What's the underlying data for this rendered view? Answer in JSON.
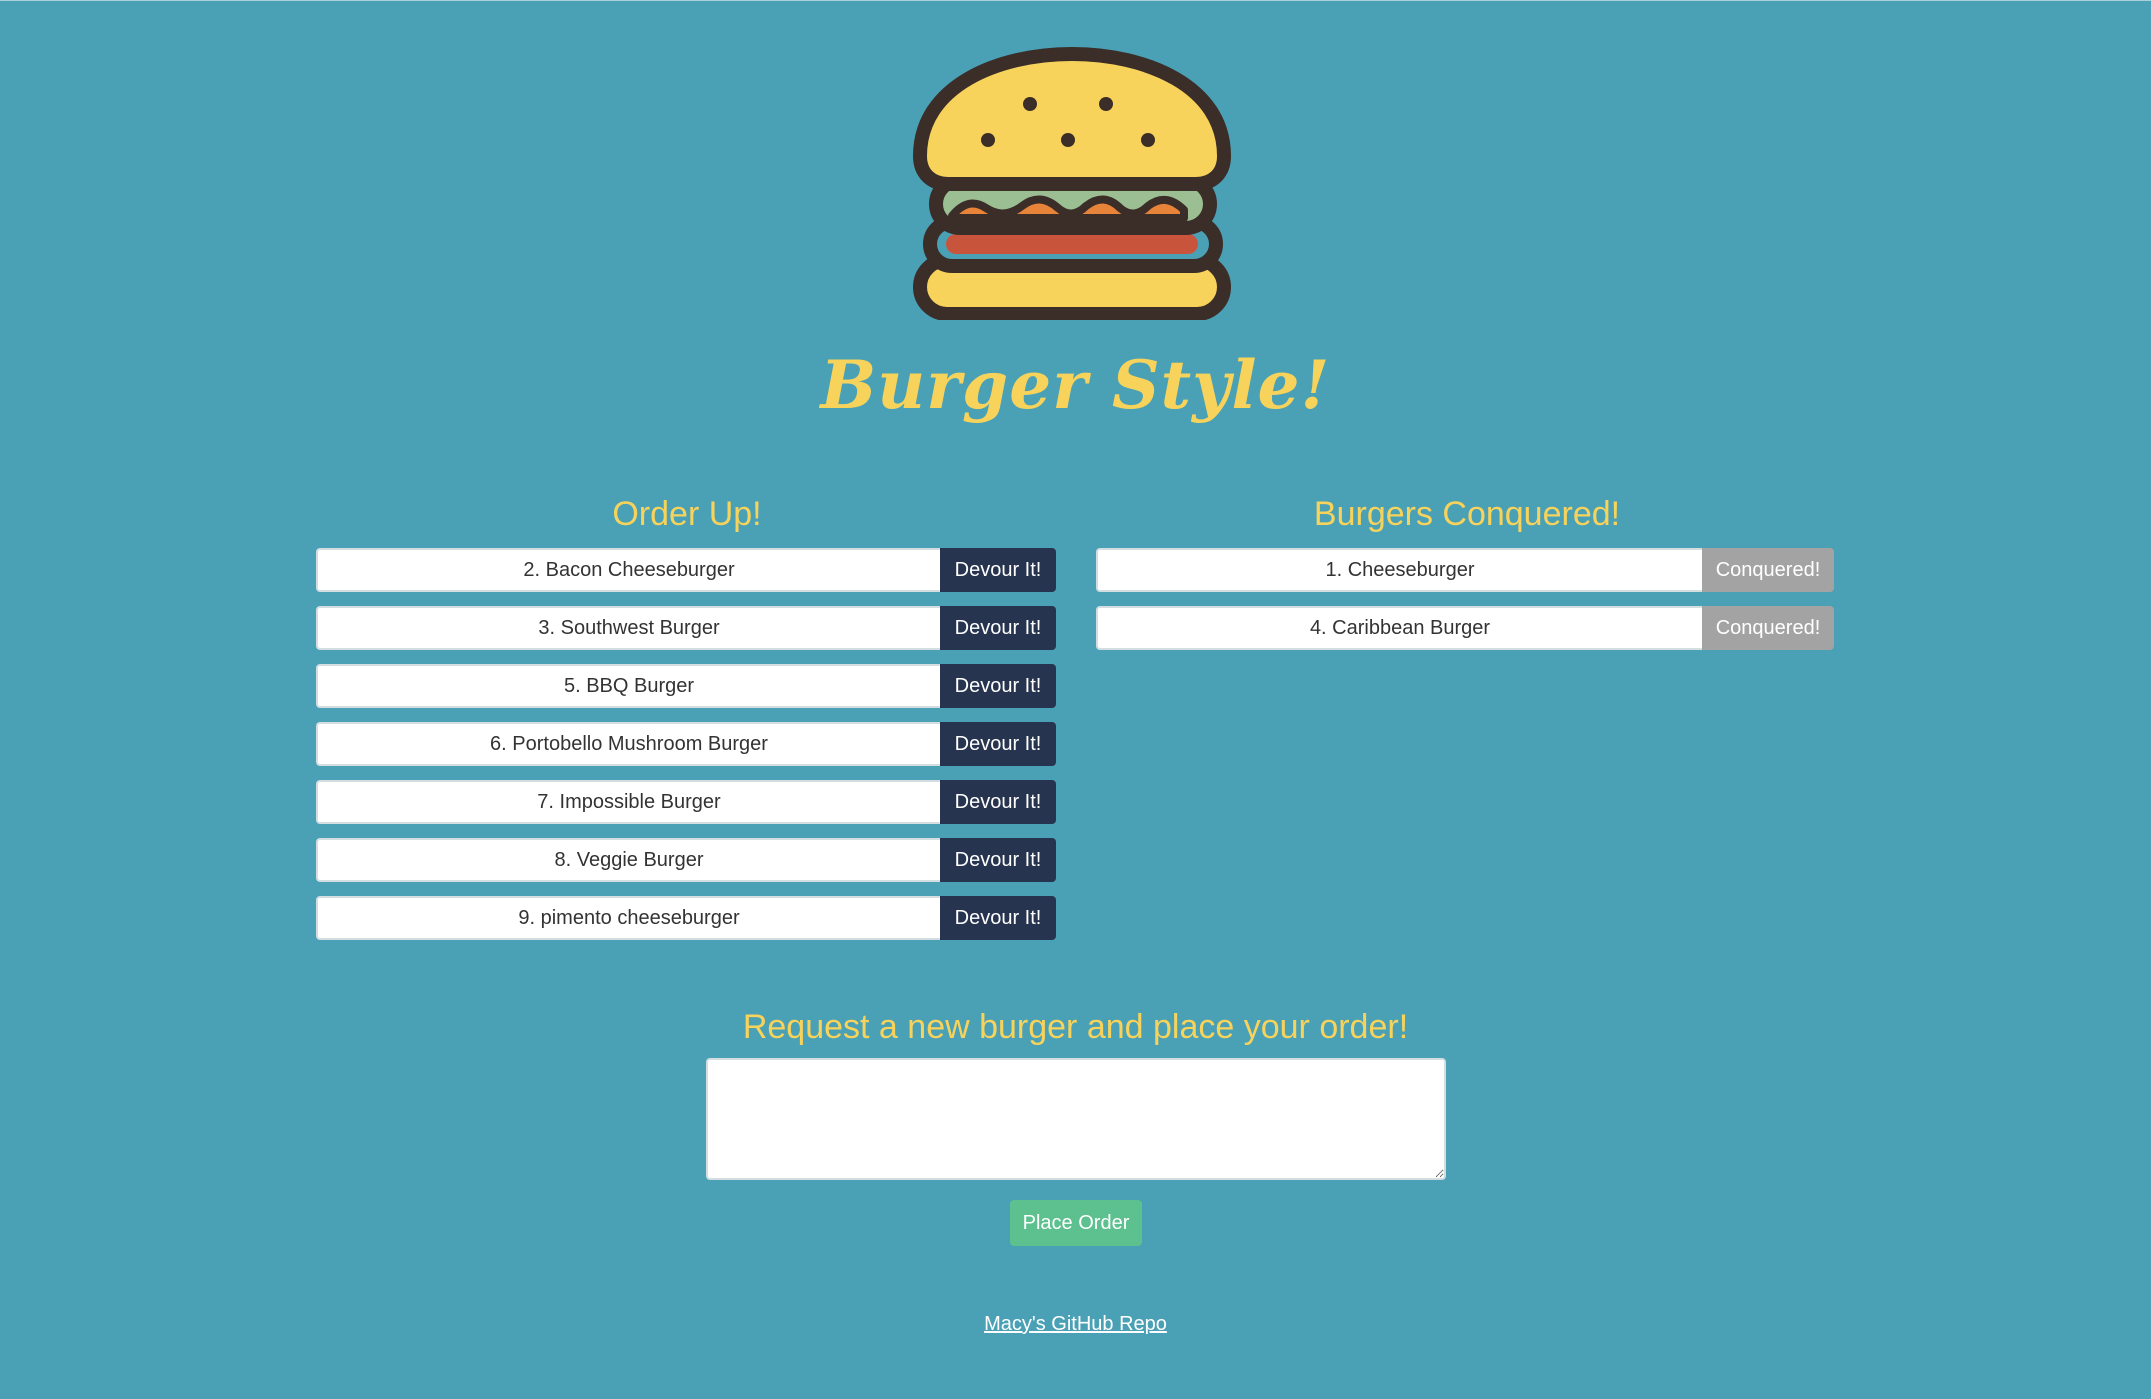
{
  "app": {
    "title": "Burger Style!",
    "logo_icon": "burger-icon"
  },
  "colors": {
    "background": "#4aa0b5",
    "accent_yellow": "#f7d35c",
    "devour_button": "#26344f",
    "conquered_button": "#a3a3a3",
    "place_order_button": "#5cc08f"
  },
  "order_up": {
    "heading": "Order Up!",
    "button_label": "Devour It!",
    "items": [
      {
        "label": "2. Bacon Cheeseburger"
      },
      {
        "label": "3. Southwest Burger"
      },
      {
        "label": "5. BBQ Burger"
      },
      {
        "label": "6. Portobello Mushroom Burger"
      },
      {
        "label": "7. Impossible Burger"
      },
      {
        "label": "8. Veggie Burger"
      },
      {
        "label": "9. pimento cheeseburger"
      }
    ]
  },
  "conquered": {
    "heading": "Burgers Conquered!",
    "button_label": "Conquered!",
    "items": [
      {
        "label": "1. Cheeseburger"
      },
      {
        "label": "4. Caribbean Burger"
      }
    ]
  },
  "request": {
    "heading": "Request a new burger and place your order!",
    "input_value": "",
    "button_label": "Place Order"
  },
  "footer": {
    "link_text": "Macy's GitHub Repo"
  }
}
